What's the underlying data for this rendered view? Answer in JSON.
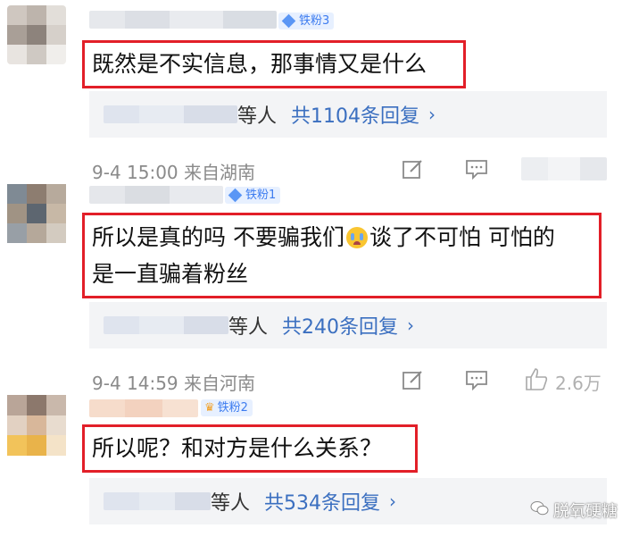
{
  "comments": [
    {
      "badge": "铁粉3",
      "text": "既然是不实信息，那事情又是什么",
      "reply_people": "等人",
      "reply_link": "共1104条回复"
    },
    {
      "meta": "9-4 15:00 来自湖南",
      "badge": "铁粉1",
      "text_line1": "所以是真的吗 不要骗我们",
      "text_line1b": "谈了不可怕 可怕的",
      "text_line2": "是一直骗着粉丝",
      "reply_people": "等人",
      "reply_link": "共240条回复"
    },
    {
      "meta": "9-4 14:59 来自河南",
      "badge": "铁粉2",
      "text": "所以呢？和对方是什么关系？",
      "reply_people": "等人",
      "reply_link": "共534条回复",
      "partial_like": "2.6万"
    }
  ],
  "chevron": "›",
  "watermark": "脱氧硬糖",
  "icons": {
    "edit": "edit-icon",
    "comment": "comment-icon",
    "like": "like-icon",
    "crying_emoji": "crying-emoji",
    "crown": "crown-icon",
    "wechat": "wechat-icon"
  }
}
